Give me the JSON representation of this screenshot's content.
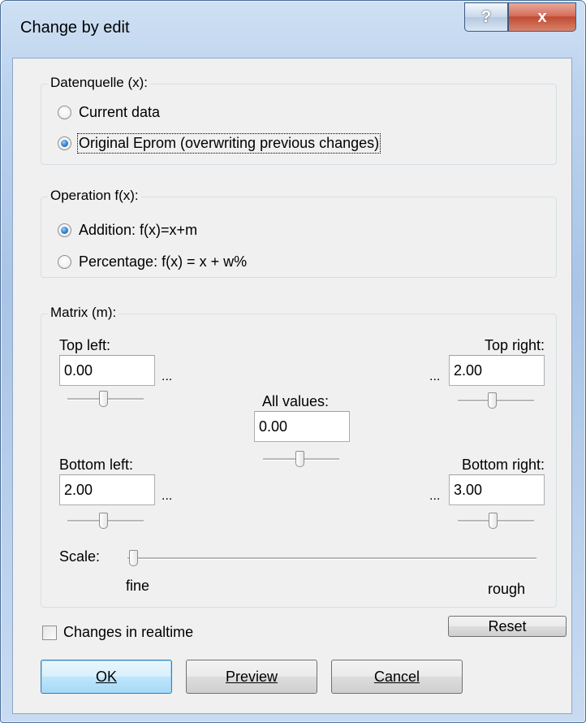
{
  "window": {
    "title": "Change by edit",
    "help_label": "?",
    "close_label": "x"
  },
  "datasource": {
    "title": "Datenquelle (x):",
    "options": [
      {
        "label": "Current data",
        "checked": false
      },
      {
        "label": "Original Eprom (overwriting previous changes)",
        "checked": true
      }
    ]
  },
  "operation": {
    "title": "Operation f(x):",
    "options": [
      {
        "label": "Addition: f(x)=x+m",
        "checked": true
      },
      {
        "label": "Percentage: f(x) = x + w%",
        "checked": false
      }
    ]
  },
  "matrix": {
    "title": "Matrix (m):",
    "top_left": {
      "label": "Top left:",
      "value": "0.00"
    },
    "top_right": {
      "label": "Top right:",
      "value": "2.00"
    },
    "all_values": {
      "label": "All values:",
      "value": "0.00"
    },
    "bottom_left": {
      "label": "Bottom left:",
      "value": "2.00"
    },
    "bottom_right": {
      "label": "Bottom right:",
      "value": "3.00"
    },
    "ellipsis": "...",
    "scale": {
      "label": "Scale:",
      "min_label": "fine",
      "max_label": "rough",
      "value": 0
    }
  },
  "realtime": {
    "label": "Changes in realtime",
    "checked": false
  },
  "buttons": {
    "reset": "Reset",
    "ok": "OK",
    "preview": "Preview",
    "cancel": "Cancel"
  }
}
